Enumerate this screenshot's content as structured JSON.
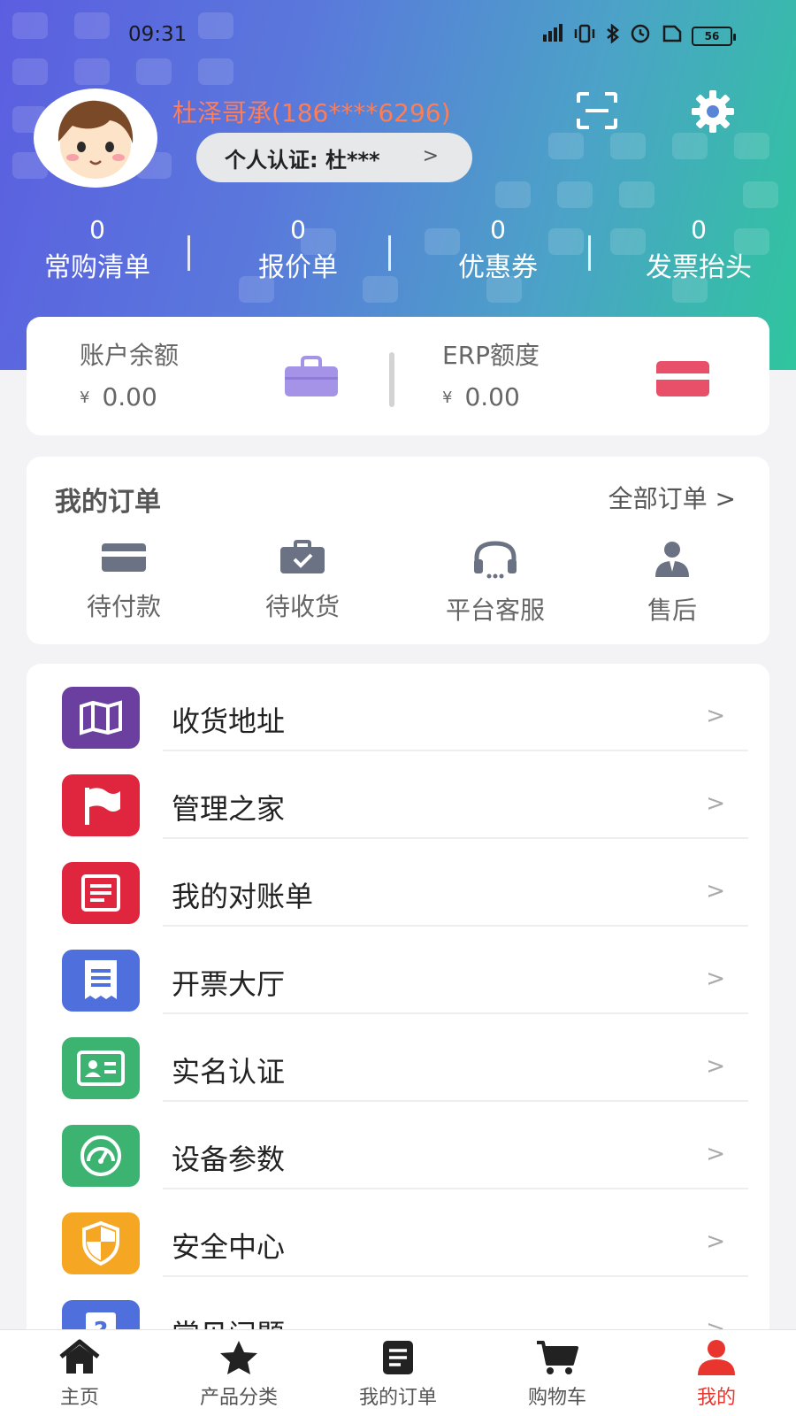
{
  "status_bar": {
    "time": "09:31",
    "network": "««",
    "battery": "56"
  },
  "profile": {
    "username": "杜泽哥承(186****6296)",
    "cert_label": "个人认证: 杜***",
    "chevron": ">"
  },
  "stats": [
    {
      "count": "0",
      "label": "常购清单"
    },
    {
      "count": "0",
      "label": "报价单"
    },
    {
      "count": "0",
      "label": "优惠券"
    },
    {
      "count": "0",
      "label": "发票抬头"
    }
  ],
  "balance": {
    "account_label": "账户余额",
    "account_currency": "¥",
    "account_value": "0.00",
    "erp_label": "ERP额度",
    "erp_currency": "¥",
    "erp_value": "0.00"
  },
  "orders": {
    "title": "我的订单",
    "all_label": "全部订单 >",
    "items": [
      {
        "label": "待付款",
        "icon": "card-icon"
      },
      {
        "label": "待收货",
        "icon": "briefcase-check-icon"
      },
      {
        "label": "平台客服",
        "icon": "headset-icon"
      },
      {
        "label": "售后",
        "icon": "service-person-icon"
      }
    ]
  },
  "menu": {
    "chevron": ">",
    "items": [
      {
        "label": "收货地址",
        "icon": "map-icon",
        "color": "#6b3fa0"
      },
      {
        "label": "管理之家",
        "icon": "flag-icon",
        "color": "#e0263f"
      },
      {
        "label": "我的对账单",
        "icon": "statement-icon",
        "color": "#e0263f"
      },
      {
        "label": "开票大厅",
        "icon": "receipt-icon",
        "color": "#4f6fdc"
      },
      {
        "label": "实名认证",
        "icon": "id-card-icon",
        "color": "#3cb371"
      },
      {
        "label": "设备参数",
        "icon": "gauge-icon",
        "color": "#3cb371"
      },
      {
        "label": "安全中心",
        "icon": "shield-icon",
        "color": "#f5a623"
      },
      {
        "label": "常见问题",
        "icon": "question-icon",
        "color": "#4f6fdc"
      }
    ]
  },
  "tabbar": {
    "items": [
      {
        "label": "主页",
        "icon": "home-icon"
      },
      {
        "label": "产品分类",
        "icon": "star-icon"
      },
      {
        "label": "我的订单",
        "icon": "orders-icon"
      },
      {
        "label": "购物车",
        "icon": "cart-icon"
      },
      {
        "label": "我的",
        "icon": "user-icon",
        "active": true
      }
    ],
    "active_color": "#e8362e"
  }
}
